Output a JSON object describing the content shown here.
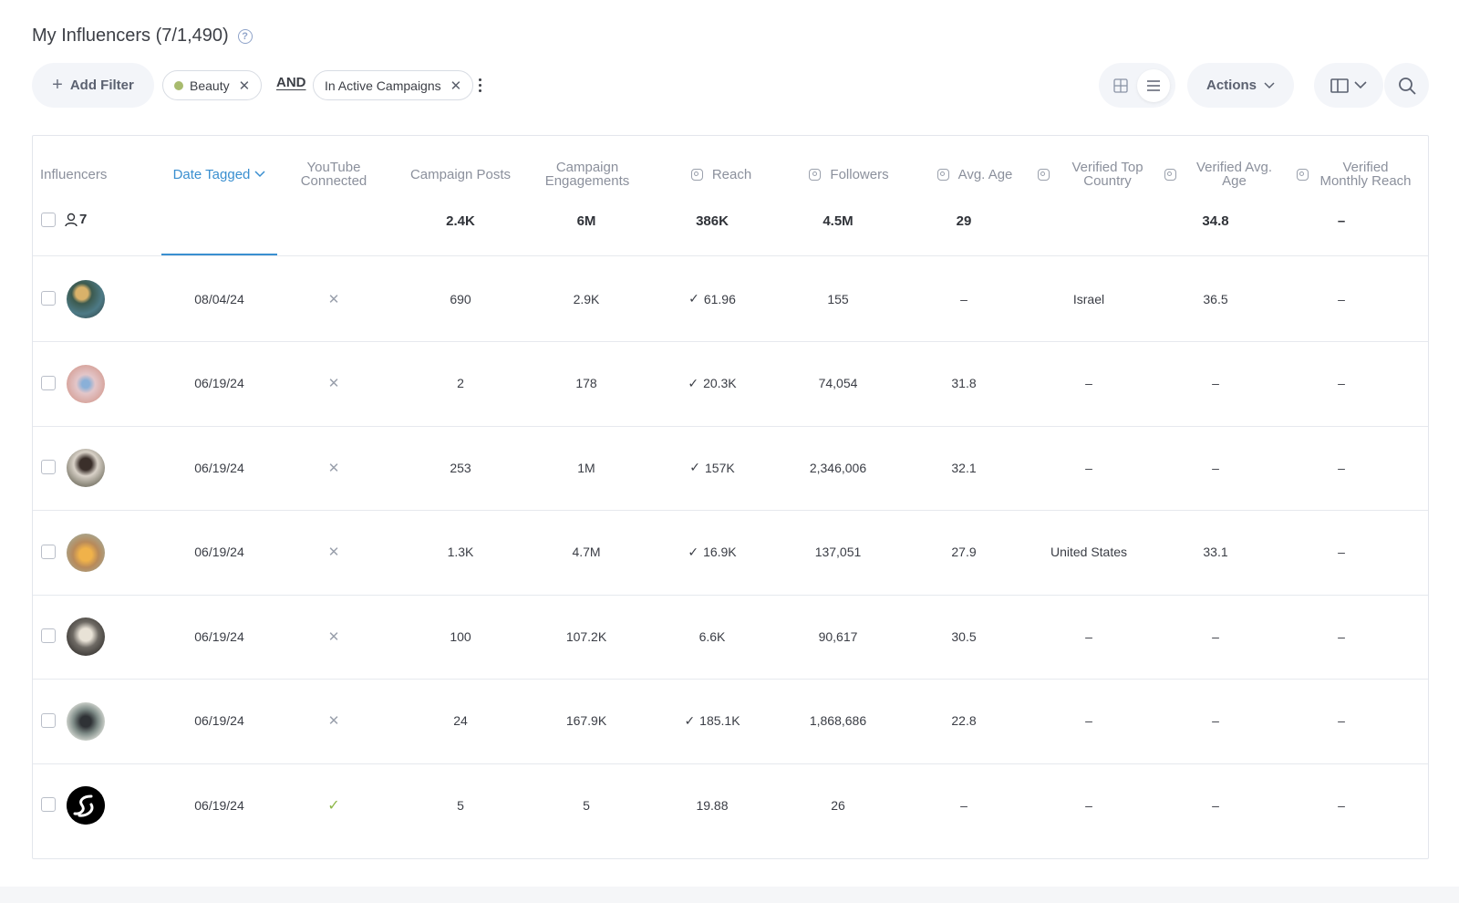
{
  "header": {
    "title": "My Influencers (7/1,490)",
    "help_icon": "question-circle-icon"
  },
  "toolbar": {
    "add_filter_label": "Add Filter",
    "filters": [
      {
        "label": "Beauty",
        "dot_color": "#a8bb6e"
      },
      {
        "label": "In Active Campaigns"
      }
    ],
    "operator": "AND",
    "actions_label": "Actions",
    "icons": {
      "grid_view": "grid-view-icon",
      "list_view": "list-view-icon",
      "columns": "columns-icon",
      "search": "search-icon"
    },
    "active_view": "list"
  },
  "table": {
    "columns": [
      {
        "key": "influencers",
        "label": "Influencers"
      },
      {
        "key": "date_tagged",
        "label": "Date Tagged",
        "sorted": true
      },
      {
        "key": "youtube",
        "label": "YouTube Connected"
      },
      {
        "key": "campaign_posts",
        "label": "Campaign Posts"
      },
      {
        "key": "campaign_engagements",
        "label": "Campaign Engagements"
      },
      {
        "key": "reach",
        "label": "Reach",
        "instagram": true
      },
      {
        "key": "followers",
        "label": "Followers",
        "instagram": true
      },
      {
        "key": "avg_age",
        "label": "Avg. Age",
        "instagram": true
      },
      {
        "key": "verified_top_country",
        "label": "Verified Top Country",
        "instagram": true
      },
      {
        "key": "verified_avg_age",
        "label": "Verified Avg. Age",
        "instagram": true
      },
      {
        "key": "verified_monthly_reach",
        "label": "Verified Monthly Reach",
        "instagram": true
      }
    ],
    "totals": {
      "count": "7",
      "campaign_posts": "2.4K",
      "campaign_engagements": "6M",
      "reach": "386K",
      "followers": "4.5M",
      "avg_age": "29",
      "verified_avg_age": "34.8",
      "verified_monthly_reach": "–"
    },
    "rows": [
      {
        "date": "08/04/24",
        "youtube": false,
        "posts": "690",
        "engagements": "2.9K",
        "reach": "61.96",
        "reach_verified": true,
        "followers": "155",
        "avg_age": "–",
        "top_country": "Israel",
        "verified_avg_age": "36.5",
        "monthly_reach": "–"
      },
      {
        "date": "06/19/24",
        "youtube": false,
        "posts": "2",
        "engagements": "178",
        "reach": "20.3K",
        "reach_verified": true,
        "followers": "74,054",
        "avg_age": "31.8",
        "top_country": "–",
        "verified_avg_age": "–",
        "monthly_reach": "–"
      },
      {
        "date": "06/19/24",
        "youtube": false,
        "posts": "253",
        "engagements": "1M",
        "reach": "157K",
        "reach_verified": true,
        "followers": "2,346,006",
        "avg_age": "32.1",
        "top_country": "–",
        "verified_avg_age": "–",
        "monthly_reach": "–"
      },
      {
        "date": "06/19/24",
        "youtube": false,
        "posts": "1.3K",
        "engagements": "4.7M",
        "reach": "16.9K",
        "reach_verified": true,
        "followers": "137,051",
        "avg_age": "27.9",
        "top_country": "United States",
        "verified_avg_age": "33.1",
        "monthly_reach": "–"
      },
      {
        "date": "06/19/24",
        "youtube": false,
        "posts": "100",
        "engagements": "107.2K",
        "reach": "6.6K",
        "reach_verified": false,
        "followers": "90,617",
        "avg_age": "30.5",
        "top_country": "–",
        "verified_avg_age": "–",
        "monthly_reach": "–"
      },
      {
        "date": "06/19/24",
        "youtube": false,
        "posts": "24",
        "engagements": "167.9K",
        "reach": "185.1K",
        "reach_verified": true,
        "followers": "1,868,686",
        "avg_age": "22.8",
        "top_country": "–",
        "verified_avg_age": "–",
        "monthly_reach": "–"
      },
      {
        "date": "06/19/24",
        "youtube": true,
        "posts": "5",
        "engagements": "5",
        "reach": "19.88",
        "reach_verified": false,
        "followers": "26",
        "avg_age": "–",
        "top_country": "–",
        "verified_avg_age": "–",
        "monthly_reach": "–"
      }
    ]
  },
  "colors": {
    "accent": "#3a8fd0",
    "youtube_connected": "#8fb84a"
  }
}
